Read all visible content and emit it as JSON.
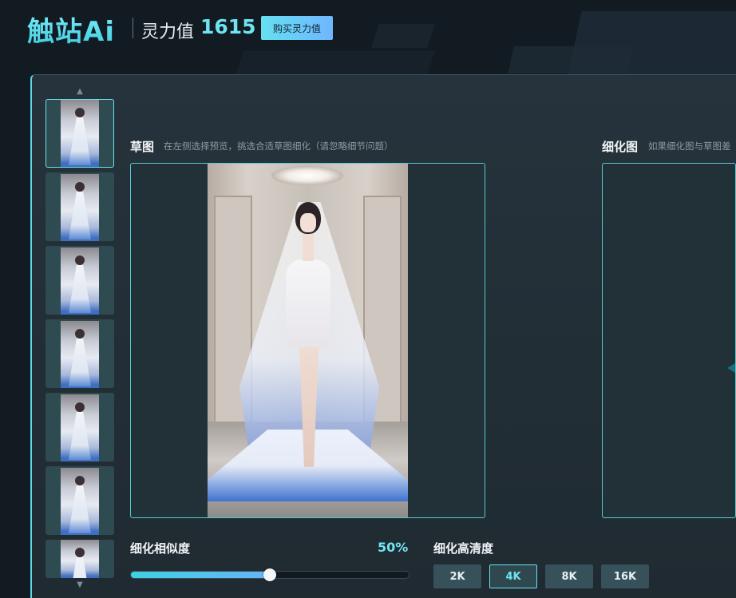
{
  "header": {
    "logo": "触站Ai",
    "power_label": "灵力值",
    "power_value": "1615",
    "buy_button": "购买灵力值"
  },
  "thumbnails": {
    "up_icon": "chevron-up-icon",
    "down_icon": "chevron-down-icon",
    "count": 7,
    "selected_index": 0
  },
  "draft": {
    "title": "草图",
    "hint": "在左侧选择预览，挑选合适草图细化（请忽略细节问题）"
  },
  "refine": {
    "title": "细化图",
    "hint": "如果细化图与草图差"
  },
  "similarity": {
    "label": "细化相似度",
    "value_text": "50%",
    "value": 0.5
  },
  "resolution": {
    "label": "细化高清度",
    "options": [
      "2K",
      "4K",
      "8K",
      "16K"
    ],
    "selected": "4K"
  },
  "colors": {
    "accent": "#6fe4f0",
    "background": "#121a22",
    "panel": "#26333c",
    "button": "#37515a"
  }
}
